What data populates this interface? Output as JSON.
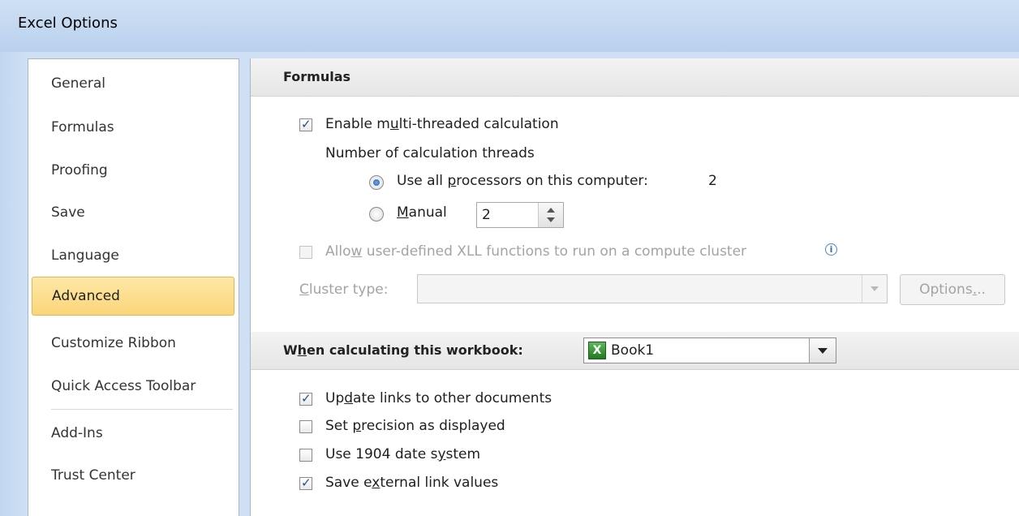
{
  "window": {
    "title": "Excel Options"
  },
  "nav": {
    "items": [
      {
        "label": "General"
      },
      {
        "label": "Formulas"
      },
      {
        "label": "Proofing"
      },
      {
        "label": "Save"
      },
      {
        "label": "Language"
      },
      {
        "label": "Advanced",
        "selected": true
      },
      {
        "label": "Customize Ribbon"
      },
      {
        "label": "Quick Access Toolbar"
      },
      {
        "label": "Add-Ins"
      },
      {
        "label": "Trust Center"
      }
    ]
  },
  "formulas": {
    "header": "Formulas",
    "multithread": {
      "label_pre": "Enable m",
      "label_u": "u",
      "label_post": "lti-threaded calculation",
      "checked": true
    },
    "threads_label": "Number of calculation threads",
    "use_all": {
      "label_pre": "Use all ",
      "label_u": "p",
      "label_post": "rocessors on this computer:",
      "count": "2",
      "selected": true
    },
    "manual": {
      "label_u": "M",
      "label_post": "anual",
      "value": "2",
      "selected": false
    },
    "xll": {
      "label_pre": "Allo",
      "label_u": "w",
      "label_post": " user-defined XLL functions to run on a compute cluster",
      "checked": false,
      "disabled": true,
      "info_icon": "ⓘ"
    },
    "cluster": {
      "label_u": "C",
      "label_post": "luster type:",
      "value": "",
      "options_pre": "Options",
      "options_u": ".",
      "options_post": ".."
    }
  },
  "workbook": {
    "header_pre": "W",
    "header_u": "h",
    "header_post": "en calculating this workbook:",
    "selected_workbook": "Book1",
    "options": [
      {
        "pre": "Up",
        "u": "d",
        "post": "ate links to other documents",
        "checked": true
      },
      {
        "pre": "Set ",
        "u": "p",
        "post": "recision as displayed",
        "checked": false
      },
      {
        "pre": "Use 1904 date s",
        "u": "y",
        "post": "stem",
        "checked": false
      },
      {
        "pre": "Save e",
        "u": "x",
        "post": "ternal link values",
        "checked": true
      }
    ]
  },
  "colors": {
    "selected_nav": "#fcd57a",
    "title_bar": "#c4d9f1",
    "checkbox_check": "#2b4a8a"
  }
}
